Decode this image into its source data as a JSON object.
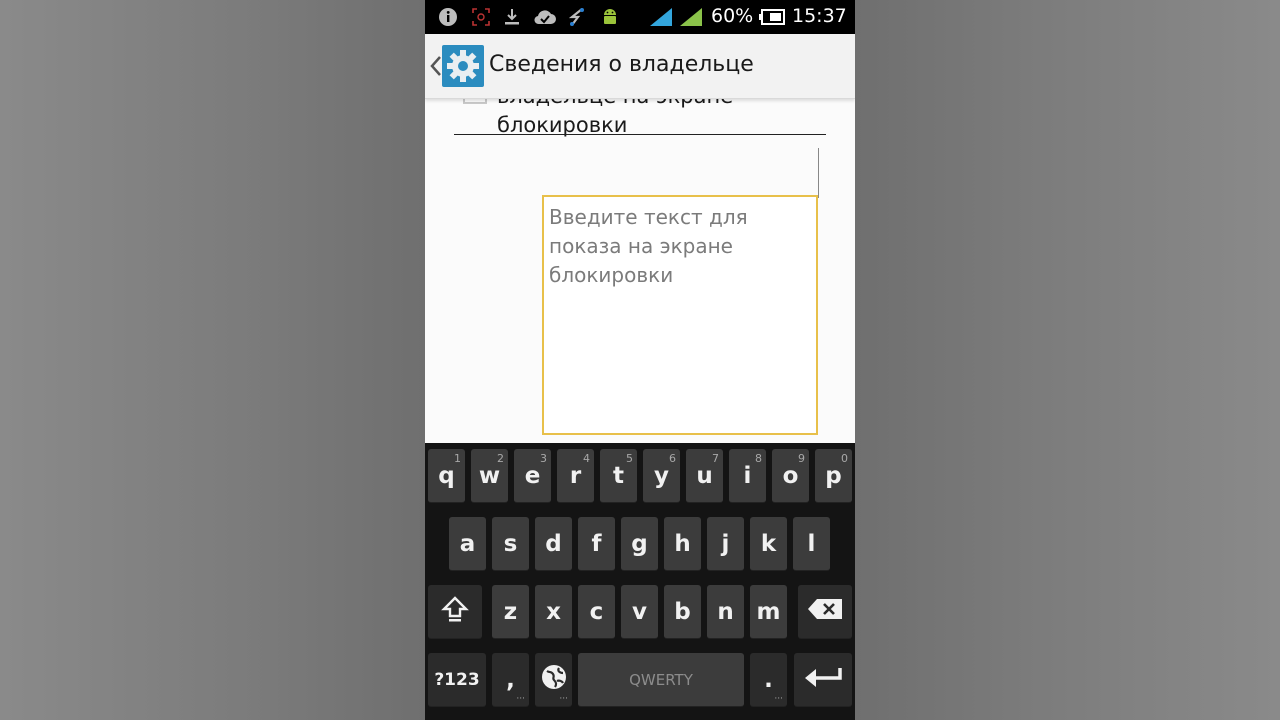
{
  "status_bar": {
    "battery": "60%",
    "time": "15:37",
    "icons": [
      "info-icon",
      "screenshot-icon",
      "download-icon",
      "cloud-icon",
      "sync-icon",
      "android-debug-icon",
      "signal-icon",
      "signal-icon-2",
      "battery-icon"
    ]
  },
  "action_bar": {
    "title": "Сведения о владельце",
    "icon": "settings-gear-icon"
  },
  "content": {
    "option_label": "владельце на экране блокировки",
    "textbox_placeholder": "Введите текст для показа на экране блокировки",
    "textbox_value": ""
  },
  "keyboard": {
    "row1": [
      {
        "key": "q",
        "hint": "1"
      },
      {
        "key": "w",
        "hint": "2"
      },
      {
        "key": "e",
        "hint": "3"
      },
      {
        "key": "r",
        "hint": "4"
      },
      {
        "key": "t",
        "hint": "5"
      },
      {
        "key": "y",
        "hint": "6"
      },
      {
        "key": "u",
        "hint": "7"
      },
      {
        "key": "i",
        "hint": "8"
      },
      {
        "key": "o",
        "hint": "9"
      },
      {
        "key": "p",
        "hint": "0"
      }
    ],
    "row2": [
      "a",
      "s",
      "d",
      "f",
      "g",
      "h",
      "j",
      "k",
      "l"
    ],
    "row3": [
      "z",
      "x",
      "c",
      "v",
      "b",
      "n",
      "m"
    ],
    "symbols_label": "?123",
    "comma_label": ",",
    "space_label": "QWERTY",
    "period_label": ".",
    "shift_icon": "shift-icon",
    "backspace_icon": "backspace-icon",
    "enter_icon": "enter-icon",
    "language_icon": "globe-icon"
  },
  "colors": {
    "textbox_border": "#e8c04a",
    "app_icon_bg": "#2b8cbf",
    "keyboard_bg": "#141414",
    "key_bg": "#3c3c3c"
  }
}
